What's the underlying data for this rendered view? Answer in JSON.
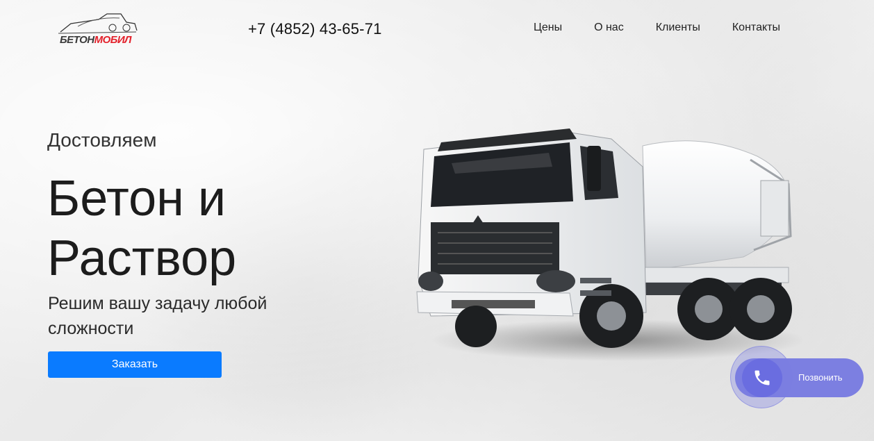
{
  "header": {
    "logo": {
      "part1": "БЕТОН",
      "part2": "МОБИЛ"
    },
    "phone": "+7 (4852) 43-65-71",
    "nav": [
      {
        "label": "Цены"
      },
      {
        "label": "О нас"
      },
      {
        "label": "Клиенты"
      },
      {
        "label": "Контакты"
      }
    ]
  },
  "hero": {
    "kicker": "Достовляем",
    "title_line1": "Бетон и",
    "title_line2": "Раствор",
    "subtitle": "Решим вашу задачу любой сложности",
    "cta": "Заказать"
  },
  "call_widget": {
    "label": "Позвонить",
    "icon": "phone-icon"
  },
  "colors": {
    "accent": "#0a7bff",
    "logo_red": "#e3212b",
    "call_widget": "#7c7fe1"
  }
}
